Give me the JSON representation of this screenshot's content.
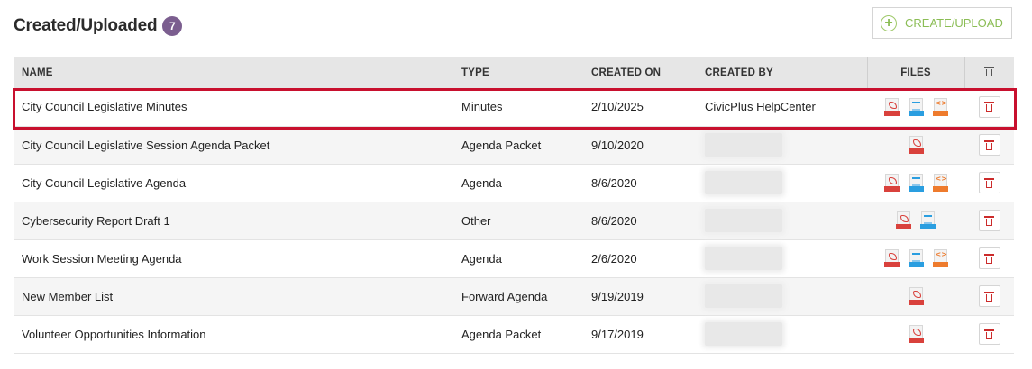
{
  "header": {
    "title": "Created/Uploaded",
    "count": "7"
  },
  "create_button": {
    "label": "CREATE/UPLOAD",
    "icon": "plus-circle-icon",
    "color": "#8bbd55"
  },
  "table": {
    "columns": {
      "name": "NAME",
      "type": "TYPE",
      "created_on": "CREATED ON",
      "created_by": "CREATED BY",
      "files": "FILES"
    },
    "rows": [
      {
        "name": "City Council Legislative Minutes",
        "type": "Minutes",
        "created_on": "2/10/2025",
        "created_by": "CivicPlus HelpCenter",
        "created_by_hidden": false,
        "files": [
          "pdf",
          "doc",
          "html"
        ],
        "highlighted": true
      },
      {
        "name": "City Council Legislative Session Agenda Packet",
        "type": "Agenda Packet",
        "created_on": "9/10/2020",
        "created_by": "",
        "created_by_hidden": true,
        "files": [
          "pdf"
        ]
      },
      {
        "name": "City Council Legislative Agenda",
        "type": "Agenda",
        "created_on": "8/6/2020",
        "created_by": "",
        "created_by_hidden": true,
        "files": [
          "pdf",
          "doc",
          "html"
        ]
      },
      {
        "name": "Cybersecurity Report Draft 1",
        "type": "Other",
        "created_on": "8/6/2020",
        "created_by": "",
        "created_by_hidden": true,
        "files": [
          "pdf",
          "doc"
        ]
      },
      {
        "name": "Work Session Meeting Agenda",
        "type": "Agenda",
        "created_on": "2/6/2020",
        "created_by": "",
        "created_by_hidden": true,
        "files": [
          "pdf",
          "doc",
          "html"
        ]
      },
      {
        "name": "New Member List",
        "type": "Forward Agenda",
        "created_on": "9/19/2019",
        "created_by": "",
        "created_by_hidden": true,
        "files": [
          "pdf"
        ]
      },
      {
        "name": "Volunteer Opportunities Information",
        "type": "Agenda Packet",
        "created_on": "9/17/2019",
        "created_by": "",
        "created_by_hidden": true,
        "files": [
          "pdf"
        ]
      }
    ]
  },
  "colors": {
    "badge": "#7b5e8f",
    "highlight": "#c8102e",
    "delete": "#cc2b2b"
  }
}
